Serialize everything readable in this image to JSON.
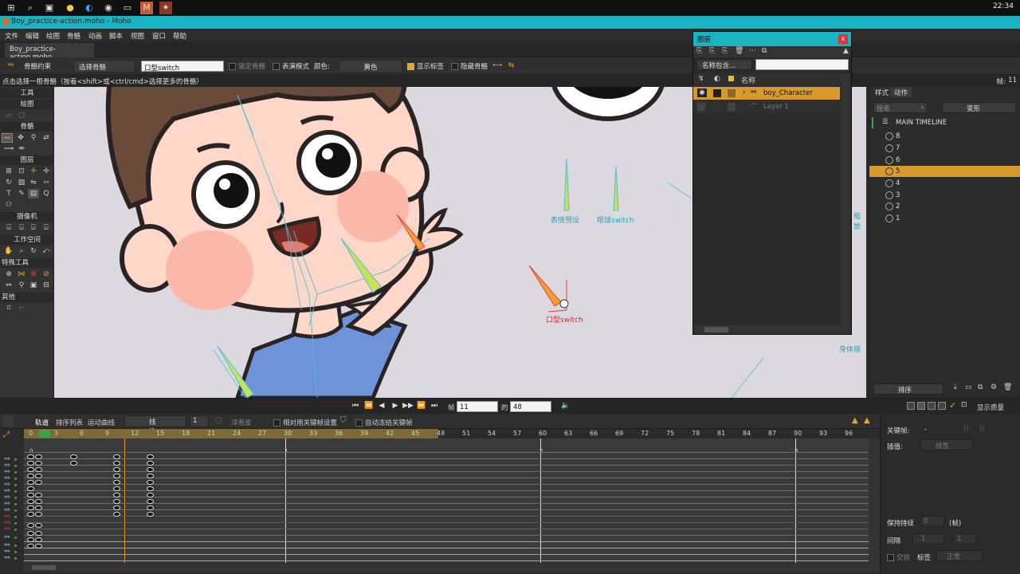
{
  "taskbar": {
    "clock": "22:34"
  },
  "window": {
    "title": "Boy_practice-action.moho - Moho"
  },
  "menu": [
    "文件",
    "编辑",
    "绘图",
    "骨骼",
    "动画",
    "脚本",
    "视图",
    "窗口",
    "帮助"
  ],
  "doc_tab": "Boy_practice-action.moho",
  "tool_options": {
    "bone_constraint": "骨骼约束",
    "select_bone": "选择骨骼",
    "bone_name": "口型switch",
    "lock_bone": "锁定骨骼",
    "independent_mode": "表演模式",
    "color_label": "颜色:",
    "color_value": "黄色",
    "show_label": "显示标签",
    "hide_bone": "隐藏骨骼"
  },
  "hint": {
    "text": "点击选择一根骨骼（按着<shift>或<ctrl/cmd>选择更多的骨骼）",
    "frame_label": "帧:",
    "frame_value": "11"
  },
  "toolbox": {
    "sections": [
      "工具",
      "绘图",
      "骨骼",
      "图层",
      "摄像机",
      "工作空间",
      "特殊工具",
      "其他"
    ]
  },
  "canvas": {
    "bone_labels": [
      "表情预设",
      "眼球switch",
      "口型switch",
      "身体缩",
      "缩放"
    ]
  },
  "layers_panel": {
    "title": "图层",
    "filter": "名称包含...",
    "column_name": "名称",
    "rows": [
      {
        "name": "boy_Character",
        "selected": true
      },
      {
        "name": "Layer 1",
        "selected": false
      }
    ]
  },
  "right_panel": {
    "tabs": [
      "样式",
      "动作"
    ],
    "search_placeholder": "搜索",
    "deform": "变形",
    "main_timeline": "MAIN TIMELINE",
    "items": [
      "8",
      "7",
      "6",
      "5",
      "4",
      "3",
      "2",
      "1"
    ],
    "selected_item": "5",
    "sort_label": "排序"
  },
  "playbar": {
    "frame_label": "帧",
    "frame_value": "11",
    "of_label": "的",
    "total_value": "48",
    "display_quality": "显示质量"
  },
  "timeline": {
    "tabs": [
      "轨道",
      "排序列表",
      "运动曲线"
    ],
    "interp": "线性",
    "interp_num": "1",
    "onion": "洋葱皮",
    "relative_kf": "相对用关键帧设置",
    "auto_freeze": "自动冻结关键帧",
    "ruler": [
      "0",
      "3",
      "6",
      "9",
      "12",
      "15",
      "18",
      "21",
      "24",
      "27",
      "30",
      "33",
      "36",
      "39",
      "42",
      "45",
      "48",
      "51",
      "54",
      "57",
      "60",
      "63",
      "66",
      "69",
      "72",
      "75",
      "78",
      "81",
      "84",
      "87",
      "90",
      "93",
      "96"
    ],
    "markers": [
      "0",
      "1",
      "2",
      "3"
    ]
  },
  "props": {
    "keyframe_label": "关键帧:",
    "keyframe_value": "-",
    "interp_label": "插值:",
    "interp_value": "线性",
    "hold_label": "保持持续",
    "hold_unit": "(帧)",
    "hold_value": "0",
    "cycle_label": "间隔",
    "cycle_value": "1",
    "cycle_value2": "1",
    "alt_label": "交错",
    "tag_label": "标签",
    "tag_value": "正常"
  },
  "colors": {
    "accent": "#19b4c4",
    "selected": "#d79a2b",
    "canvas_bg": "#dcd8e0"
  }
}
